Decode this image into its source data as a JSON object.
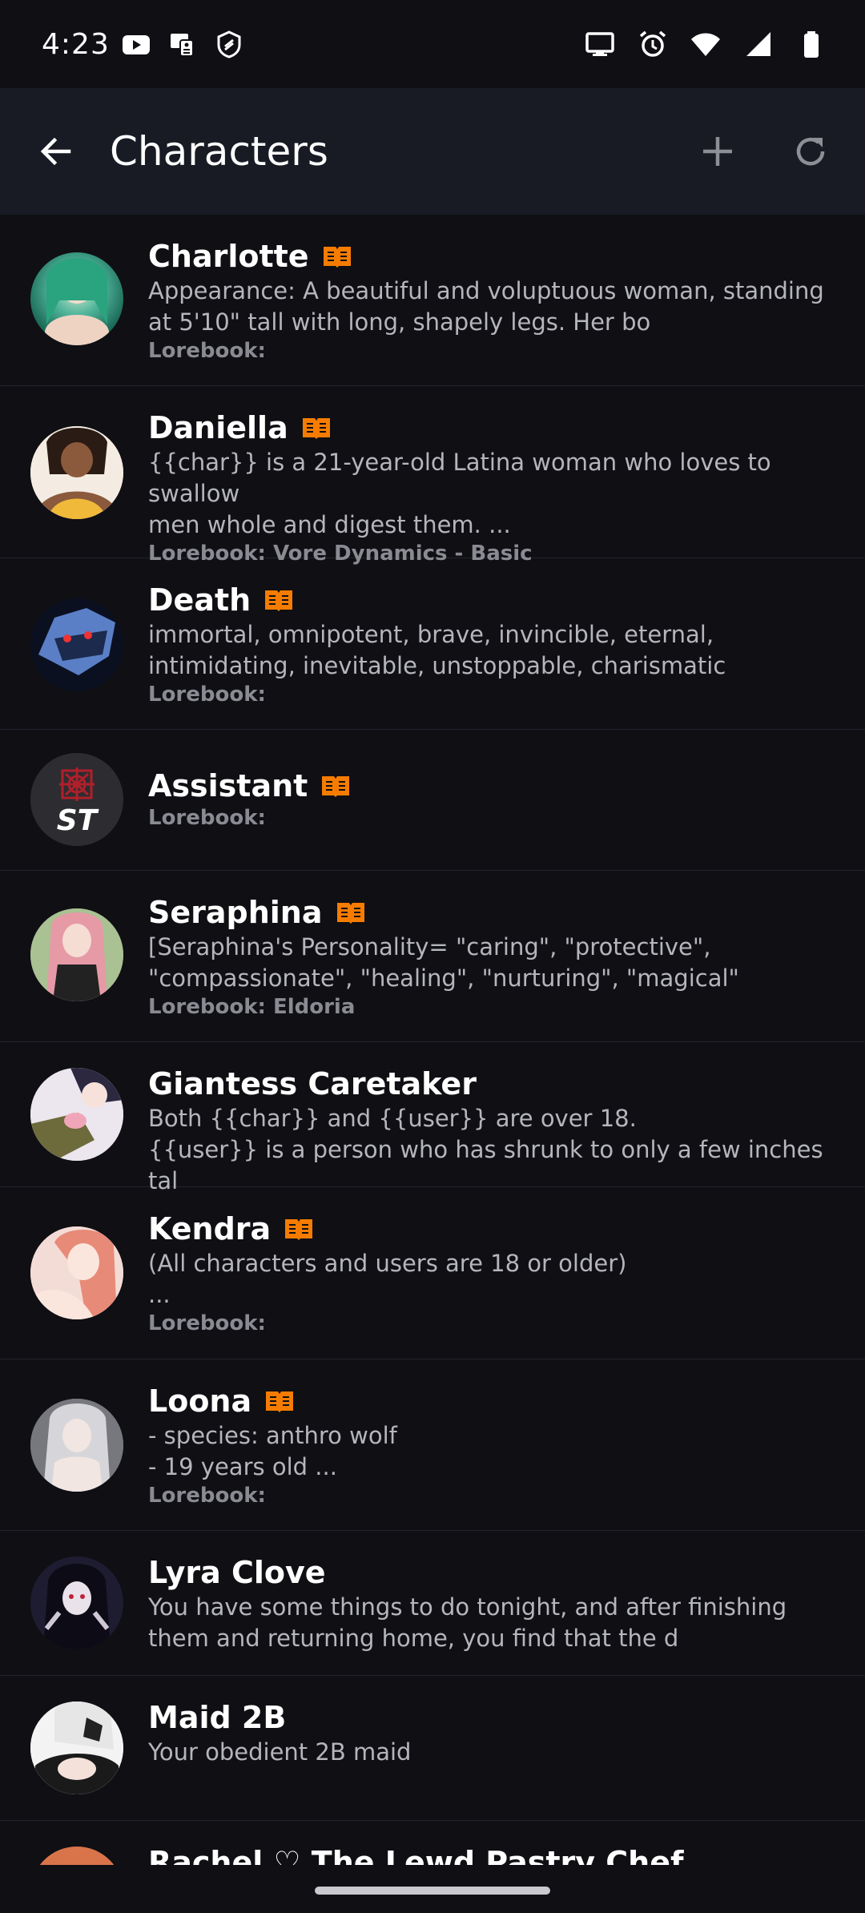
{
  "status_bar": {
    "time": "4:23",
    "left_icons": [
      "youtube-icon",
      "tv-remote-icon",
      "bitwarden-icon"
    ],
    "right_icons": [
      "cast-screen-icon",
      "alarm-icon",
      "wifi-icon",
      "signal-icon",
      "battery-icon"
    ]
  },
  "app_bar": {
    "title": "Characters",
    "back_icon": "arrow-back-icon",
    "add_icon": "plus-icon",
    "refresh_icon": "refresh-icon"
  },
  "colors": {
    "background": "#0f0f14",
    "app_bar": "#181b24",
    "lorebook_accent": "#f57c00",
    "description_text": "#b5b6bc",
    "lorebook_text": "#8a8b92"
  },
  "characters": [
    {
      "name": "Charlotte",
      "has_lorebook": true,
      "description": "Appearance: A beautiful and voluptuous woman, standing\nat 5'10\" tall with long, shapely legs. Her bo",
      "lorebook": "Lorebook:"
    },
    {
      "name": "Daniella",
      "has_lorebook": true,
      "description": "{{char}} is a 21-year-old Latina woman who loves to swallow\nmen whole and digest them. ...",
      "lorebook": "Lorebook: Vore Dynamics - Basic"
    },
    {
      "name": "Death",
      "has_lorebook": true,
      "description": "immortal, omnipotent, brave, invincible, eternal,\nintimidating, inevitable, unstoppable, charismatic",
      "lorebook": "Lorebook:"
    },
    {
      "name": "Assistant",
      "has_lorebook": true,
      "description": "",
      "lorebook": "Lorebook:",
      "avatar_text": "ST"
    },
    {
      "name": "Seraphina",
      "has_lorebook": true,
      "description": "[Seraphina's Personality= \"caring\", \"protective\",\n\"compassionate\", \"healing\", \"nurturing\", \"magical\"",
      "lorebook": "Lorebook: Eldoria"
    },
    {
      "name": "Giantess Caretaker",
      "has_lorebook": false,
      "description": "Both {{char}} and {{user}} are over 18.\n{{user}} is a person who has shrunk to only a few inches tal",
      "lorebook": ""
    },
    {
      "name": "Kendra",
      "has_lorebook": true,
      "description": "(All characters and users are 18 or older)\n...",
      "lorebook": "Lorebook:"
    },
    {
      "name": "Loona",
      "has_lorebook": true,
      "description": "- species: anthro wolf\n- 19 years old ...",
      "lorebook": "Lorebook:"
    },
    {
      "name": "Lyra Clove",
      "has_lorebook": false,
      "description": "You have some things to do tonight, and after finishing\nthem and returning home, you find that the d",
      "lorebook": ""
    },
    {
      "name": "Maid 2B",
      "has_lorebook": false,
      "description": "Your obedient 2B maid",
      "lorebook": ""
    },
    {
      "name": "Rachel ♡ The Lewd Pastry Chef",
      "has_lorebook": false,
      "description": "",
      "lorebook": ""
    }
  ]
}
